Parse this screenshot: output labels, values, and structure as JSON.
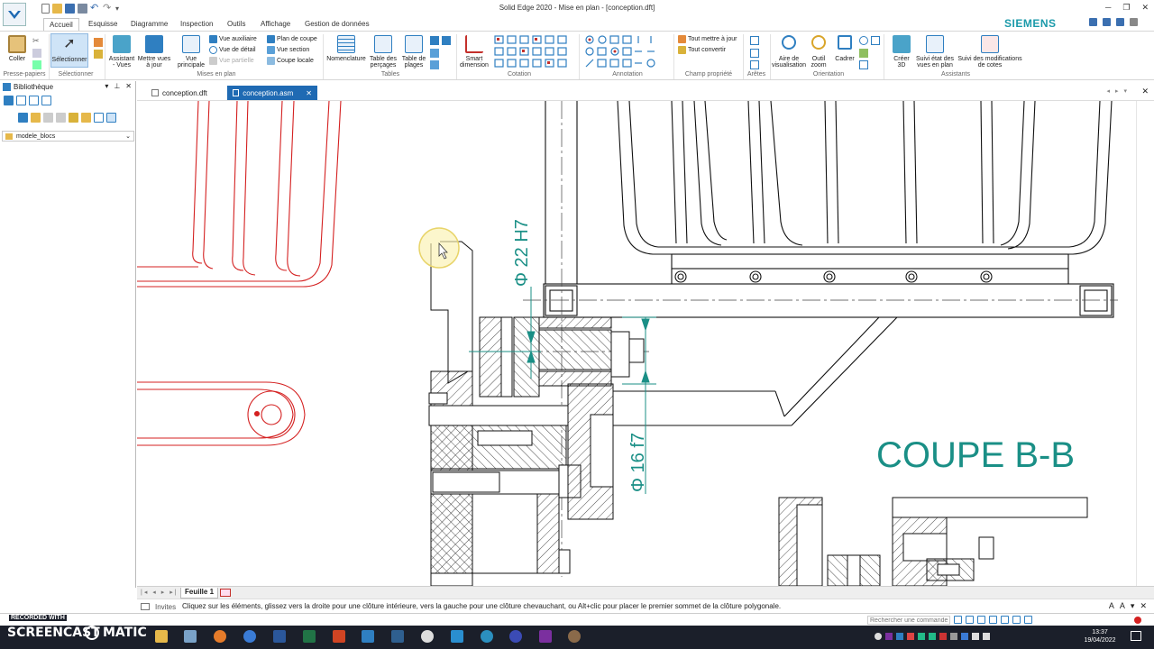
{
  "app": {
    "title": "Solid Edge 2020 - Mise en plan - [conception.dft]",
    "brand": "SIEMENS"
  },
  "ribbon_tabs": [
    "Accueil",
    "Esquisse",
    "Diagramme",
    "Inspection",
    "Outils",
    "Affichage",
    "Gestion de données"
  ],
  "ribbon": {
    "presse": {
      "coller": "Coller",
      "group": "Presse-papiers"
    },
    "selection": {
      "selectionner": "Sélectionner",
      "group": "Sélectionner"
    },
    "vues": {
      "assistant": "Assistant\n- Vues",
      "mettre": "Mettre vues\nà jour"
    },
    "mises_en_plan": {
      "vue_principale": "Vue\nprincipale",
      "vue_auxiliaire": "Vue auxiliaire",
      "vue_detail": "Vue de détail",
      "vue_partielle": "Vue partielle",
      "plan_coupe": "Plan de coupe",
      "vue_section": "Vue section",
      "coupe_locale": "Coupe locale",
      "group": "Mises en plan"
    },
    "tables": {
      "nomenclature": "Nomenclature",
      "percages": "Table des\nperçages",
      "plages": "Table de\nplages",
      "group": "Tables"
    },
    "cotation": {
      "smart": "Smart\ndimension",
      "group": "Cotation"
    },
    "annotation": {
      "group": "Annotation"
    },
    "champ": {
      "tout_mettre": "Tout mettre à jour",
      "tout_convertir": "Tout convertir",
      "group": "Champ propriété"
    },
    "aretes": {
      "group": "Arêtes"
    },
    "orientation": {
      "aire": "Aire de\nvisualisation",
      "outil": "Outil\nzoom",
      "cadrer": "Cadrer",
      "group": "Orientation"
    },
    "assistants": {
      "creer": "Créer\n3D",
      "suivi_etat": "Suivi état des\nvues en plan",
      "suivi_mod": "Suivi des modifications\nde cotes",
      "group": "Assistants"
    }
  },
  "library": {
    "title": "Bibliothèque",
    "folder": "modele_blocs"
  },
  "doc_tabs": [
    {
      "label": "conception.dft",
      "active": false
    },
    {
      "label": "conception.asm",
      "active": true
    }
  ],
  "drawing": {
    "section_title": "COUPE B-B",
    "dim_upper": "Φ 22 H7",
    "dim_lower": "Φ 16 f7"
  },
  "sheet": {
    "tab": "Feuille 1"
  },
  "status": {
    "invites_label": "Invites",
    "message": "Cliquez sur les éléments, glissez vers la droite pour une clôture intérieure, vers la gauche pour une clôture chevauchant, ou Alt+clic pour placer le premier sommet de la clôture polygonale."
  },
  "command_search": {
    "placeholder": "Rechercher une commande"
  },
  "taskbar": {
    "time": "13:37",
    "date": "19/04/2022"
  },
  "watermark": {
    "line1": "RECORDED WITH",
    "line2": "SCREENCAST",
    "line3": "MATIC"
  },
  "colors": {
    "accent": "#1f6ab3",
    "dim": "#1a8f86",
    "red_view": "#d42020",
    "brand": "#1b9aaa"
  }
}
